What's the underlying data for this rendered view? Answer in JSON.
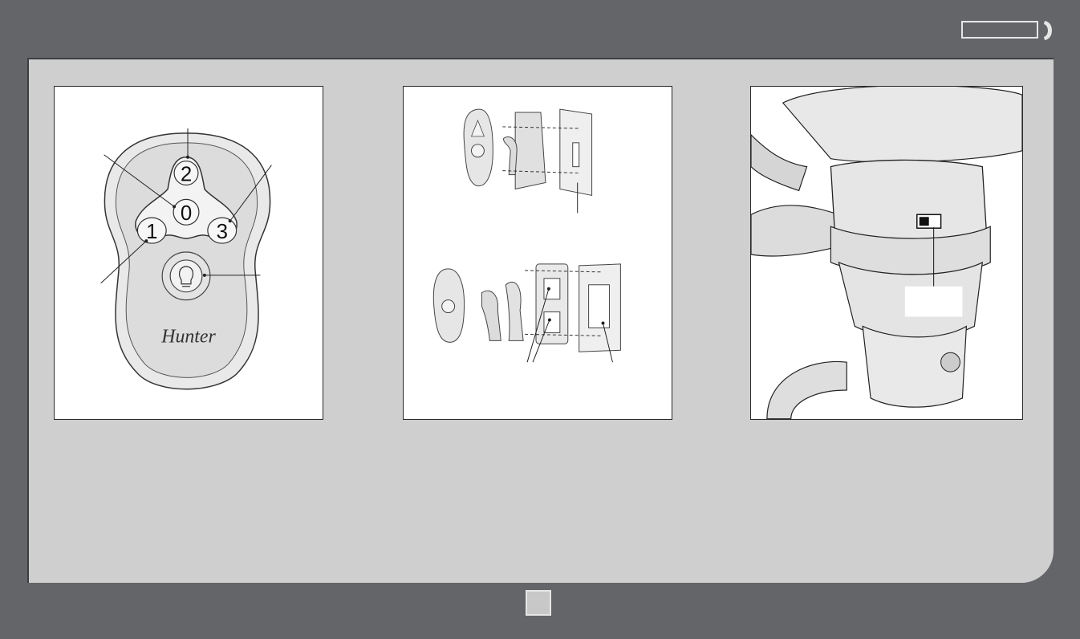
{
  "header": {
    "badge_icon": "phone-icon"
  },
  "figures": {
    "remote": {
      "buttons": [
        "0",
        "1",
        "2",
        "3"
      ],
      "light_icon": "light-bulb-icon",
      "brand": "Hunter"
    },
    "wall_mount": {
      "top_icon": "toggle-wall-plate",
      "bottom_icon": "rocker-wall-plate"
    },
    "fan_switch": {
      "switch_icon": "slide-switch-icon"
    }
  },
  "footer": {
    "page_icon": "page-square"
  },
  "colors": {
    "background": "#646569",
    "panel": "#cfcfcf",
    "figure_bg": "#ffffff"
  }
}
